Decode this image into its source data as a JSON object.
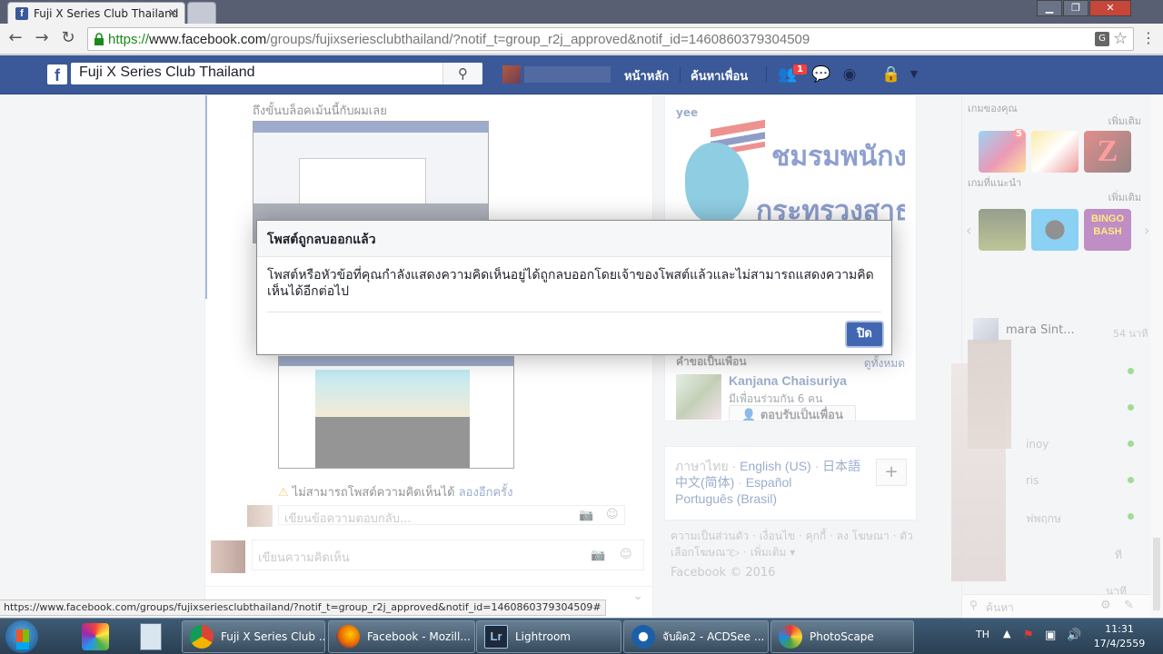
{
  "browser": {
    "tab_title": "Fuji X Series Club Thailand",
    "tab_favicon": "f",
    "url_scheme": "https://",
    "url_host": "www.facebook.com",
    "url_path": "/groups/fujixseriesclubthailand/?notif_t=group_r2j_approved&notif_id=1460860379304509",
    "status_url": "https://www.facebook.com/groups/fujixseriesclubthailand/?notif_t=group_r2j_approved&notif_id=1460860379304509#"
  },
  "fb": {
    "logo": "f",
    "search_value": "Fuji X Series Club Thailand",
    "nav_home": "หน้าหลัก",
    "nav_find_friends": "ค้นหาเพื่อน",
    "notif_count": "1"
  },
  "feed": {
    "comment_text": "ถึงขั้นบล็อคเม้นนี้กับผมเลย",
    "error_text": "ไม่สามารถโพสต์ความคิดเห็นได้",
    "retry_link": "ลองอีกครั้ง",
    "reply_placeholder": "เขียนข้อความตอบกลับ...",
    "comment_placeholder": "เขียนความคิดเห็น"
  },
  "right_col": {
    "ad_brand": "yee",
    "ad_line1": "ชมรมพนักง",
    "ad_line2": "กระทรวงสาธา",
    "pymk_title": "คำขอเป็นเพื่อน",
    "pymk_see_all": "ดูทั้งหมด",
    "pymk_name": "Kanjana Chaisuriya",
    "pymk_mutual": "มีเพื่อนร่วมกัน 6 คน",
    "pymk_add_label": "ตอบรับเป็นเพื่อน",
    "languages": {
      "current": "ภาษาไทย",
      "l1": "English (US)",
      "l2": "日本語",
      "l3": "中文(简体)",
      "l4": "Español",
      "l5": "Português (Brasil)"
    },
    "lang_add": "+",
    "footer_links": "ความเป็นส่วนตัว · เงื่อนไข · คุกกี้ · ลง โฆษณา · ตัวเลือกโฆษณา▷ · เพิ่มเติม ▾",
    "copyright": "Facebook © 2016"
  },
  "sidebar": {
    "your_games": "เกมของคุณ",
    "more1": "เพิ่มเติม",
    "recommended_games": "เกมที่แนะนำ",
    "more2": "เพิ่มเติม",
    "candy_badge": "5",
    "bingo_label": "BINGO BASH",
    "chat_name": "mara Sint...",
    "chat_time": "54 นาที",
    "chat_frag1": "inoy",
    "chat_frag2": "ris",
    "chat_frag3": "ฟพฤกษ",
    "chat_frag4": "ที",
    "chat_frag5": "นาที",
    "search_placeholder": "ค้นหา"
  },
  "dialog": {
    "title": "โพสต์ถูกลบออกแล้ว",
    "body": "โพสต์หรือหัวข้อที่คุณกำลังแสดงความคิดเห็นอยู่ได้ถูกลบออกโดยเจ้าของโพสต์แล้วและไม่สามารถแสดงความคิดเห็นได้อีกต่อไป",
    "close_label": "ปิด"
  },
  "taskbar": {
    "task_chrome": "Fuji X Series Club ...",
    "task_firefox": "Facebook - Mozill...",
    "task_lightroom": "Lightroom",
    "task_acdsee": "จับผิด2 - ACDSee ...",
    "task_photoscape": "PhotoScape",
    "tray_lang": "TH",
    "time": "11:31",
    "date": "17/4/2559"
  }
}
